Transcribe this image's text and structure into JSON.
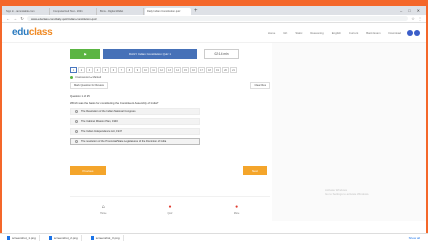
{
  "browser": {
    "tabs": [
      "Sign in - iamnotable.com",
      "Computerized Test - 2021",
      "Bmw - Digital Wallet",
      "Daily Indian Constitution quiz"
    ],
    "new_tab": "+",
    "url": "www.educlass.com/daily-quiz/indian-constitution-quiz"
  },
  "site": {
    "logo_part1": "edu",
    "logo_part2": "class",
    "menu": [
      "Home",
      "GK",
      "Static",
      "Reasoning",
      "English",
      "Current",
      "Bank Exam",
      "Download"
    ],
    "social_colors": [
      "#3b5ec9",
      "#3b5ec9"
    ]
  },
  "quiz": {
    "flag_label": "⚑",
    "title": "DAILY Indian Constitution Quiz 1",
    "timer": "02:14 min",
    "question_numbers": [
      "1",
      "2",
      "3",
      "4",
      "5",
      "6",
      "7",
      "8",
      "9",
      "10",
      "11",
      "12",
      "13",
      "14",
      "15",
      "16",
      "17",
      "18",
      "19",
      "20",
      "21"
    ],
    "status": "Unanswered ● Marked",
    "mark_button": "Mark Question for Review",
    "clear_button": "Clear Res",
    "question_title": "Question 1 of 25",
    "question_text": "Which was the basis for constituting the Constituent Assembly of India?",
    "options": [
      "The Resolution of the Indian National Congress",
      "The Cabinet Mission Plan, 1946",
      "The Indian Independence Act, 1947",
      "The resolution of the Provincial/State Legislatures of the Dominion of India"
    ],
    "prev_button": "Previous",
    "next_button": "Next"
  },
  "bottom_nav": {
    "home": "Home",
    "quiz": "Quiz",
    "more": "More"
  },
  "watermark": {
    "line1": "Activate Windows",
    "line2": "Go to Settings to activate Windows."
  },
  "downloads": {
    "items": [
      "screenshot_1.png",
      "screenshot_2.png",
      "screenshot_3.png"
    ],
    "show_all": "Show all"
  }
}
